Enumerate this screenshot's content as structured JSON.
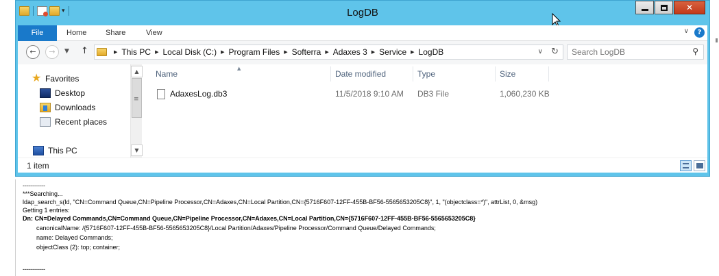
{
  "window": {
    "title": "LogDB"
  },
  "ribbon": {
    "tabs": [
      "File",
      "Home",
      "Share",
      "View"
    ]
  },
  "address": {
    "crumbs": [
      "This PC",
      "Local Disk (C:)",
      "Program Files",
      "Softerra",
      "Adaxes 3",
      "Service",
      "LogDB"
    ],
    "search_placeholder": "Search LogDB"
  },
  "nav": {
    "items": [
      {
        "label": "Favorites",
        "icon": "star-icon"
      },
      {
        "label": "Desktop",
        "icon": "desktop-icon"
      },
      {
        "label": "Downloads",
        "icon": "downloads-icon"
      },
      {
        "label": "Recent places",
        "icon": "recent-places-icon"
      },
      {
        "label": "This PC",
        "icon": "computer-icon"
      }
    ]
  },
  "files": {
    "columns": [
      "Name",
      "Date modified",
      "Type",
      "Size"
    ],
    "rows": [
      {
        "name": "AdaxesLog.db3",
        "modified": "11/5/2018 9:10 AM",
        "type": "DB3 File",
        "size": "1,060,230 KB"
      }
    ]
  },
  "status": {
    "text": "1 item"
  },
  "log": {
    "lines": [
      "-----------",
      "***Searching...",
      "ldap_search_s(ld, \"CN=Command Queue,CN=Pipeline Processor,CN=Adaxes,CN=Local Partition,CN={5716F607-12FF-455B-BF56-5565653205C8}\", 1, \"(objectclass=*)\", attrList,  0, &msg)",
      "Getting 1 entries:",
      "Dn: CN=Delayed Commands,CN=Command Queue,CN=Pipeline Processor,CN=Adaxes,CN=Local Partition,CN={5716F607-12FF-455B-BF56-5565653205C8}",
      "canonicalName: /{5716F607-12FF-455B-BF56-5565653205C8}/Local Partition/Adaxes/Pipeline Processor/Command Queue/Delayed Commands;",
      "name: Delayed Commands;",
      "objectClass (2): top; container;",
      "-----------"
    ]
  }
}
